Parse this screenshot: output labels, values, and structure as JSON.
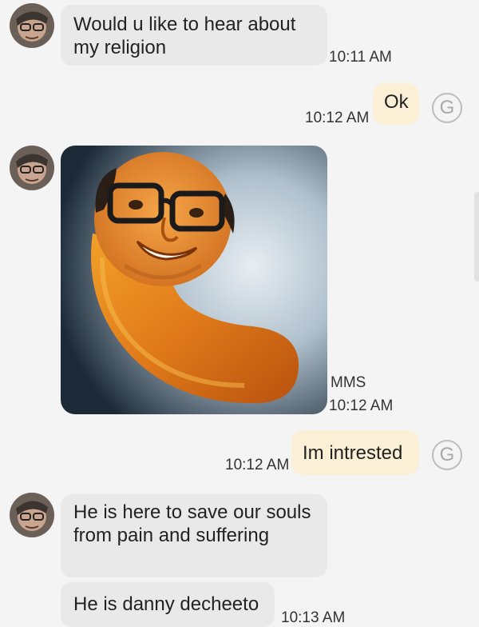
{
  "conversation": {
    "messages": [
      {
        "sender": "contact",
        "text": "Would u like to hear about my religion",
        "time": "10:11 AM"
      },
      {
        "sender": "me",
        "text": "Ok",
        "time": "10:12 AM",
        "badge": "G"
      },
      {
        "sender": "contact",
        "type": "mms",
        "label": "MMS",
        "time": "10:12 AM"
      },
      {
        "sender": "me",
        "text": "Im intrested",
        "time": "10:12 AM",
        "badge": "G"
      },
      {
        "sender": "contact",
        "text": "He is here to save our souls from pain and suffering"
      },
      {
        "sender": "contact",
        "text": "He is danny decheeto",
        "time": "10:13 AM"
      }
    ]
  }
}
